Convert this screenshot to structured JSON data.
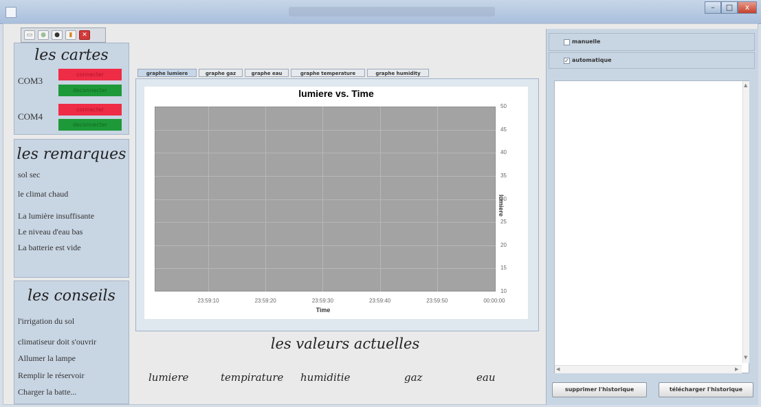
{
  "window": {
    "title": "",
    "controls": [
      "–",
      "□",
      "x"
    ]
  },
  "toolbar": {
    "icons": [
      "document-icon",
      "circle-icon",
      "record-icon",
      "chart-icon",
      "close-icon"
    ]
  },
  "cartes": {
    "title": "les cartes",
    "ports": [
      {
        "name": "COM3",
        "connect_label": "connecter",
        "disconnect_label": "deconnecter"
      },
      {
        "name": "COM4",
        "connect_label": "connecter",
        "disconnect_label": "deconnecter"
      }
    ]
  },
  "remarques": {
    "title": "les remarques",
    "items": [
      "sol sec",
      "le climat chaud",
      "La lumière insuffisante",
      "Le niveau d'eau bas",
      "La batterie est vide"
    ]
  },
  "conseils": {
    "title": "les conseils",
    "items": [
      "l'irrigation du sol",
      "climatiseur doit s'ouvrir",
      "Allumer la lampe",
      "Remplir le réservoir",
      "Charger la batte..."
    ]
  },
  "tabs": [
    {
      "label": "graphe lumiere",
      "active": true
    },
    {
      "label": "graphe gaz",
      "active": false
    },
    {
      "label": "graphe eau",
      "active": false
    },
    {
      "label": "graphe temperature",
      "active": false
    },
    {
      "label": "graphe humidity",
      "active": false
    }
  ],
  "chart_data": {
    "type": "line",
    "title": "lumiere vs. Time",
    "xlabel": "Time",
    "ylabel": "lumiere",
    "x_ticks": [
      "23:59:10",
      "23:59:20",
      "23:59:30",
      "23:59:40",
      "23:59:50",
      "00:00:00"
    ],
    "y_ticks": [
      50,
      45,
      40,
      35,
      30,
      25,
      20,
      15,
      10
    ],
    "ylim": [
      10,
      50
    ],
    "series": [],
    "grid": true,
    "plot_background": "#a3a3a3"
  },
  "values": {
    "title": "les valeurs actuelles",
    "labels": [
      "lumiere",
      "tempirature",
      "humiditie",
      "gaz",
      "eau"
    ]
  },
  "mode": {
    "manual_label": "manuelle",
    "manual_checked": false,
    "auto_label": "automatique",
    "auto_checked": true
  },
  "history": {
    "delete_label": "supprimer l'historique",
    "download_label": "télécharger l'historique"
  },
  "colors": {
    "connect": "#ee2c46",
    "disconnect": "#1e9939",
    "panel": "#c8d5e3"
  }
}
